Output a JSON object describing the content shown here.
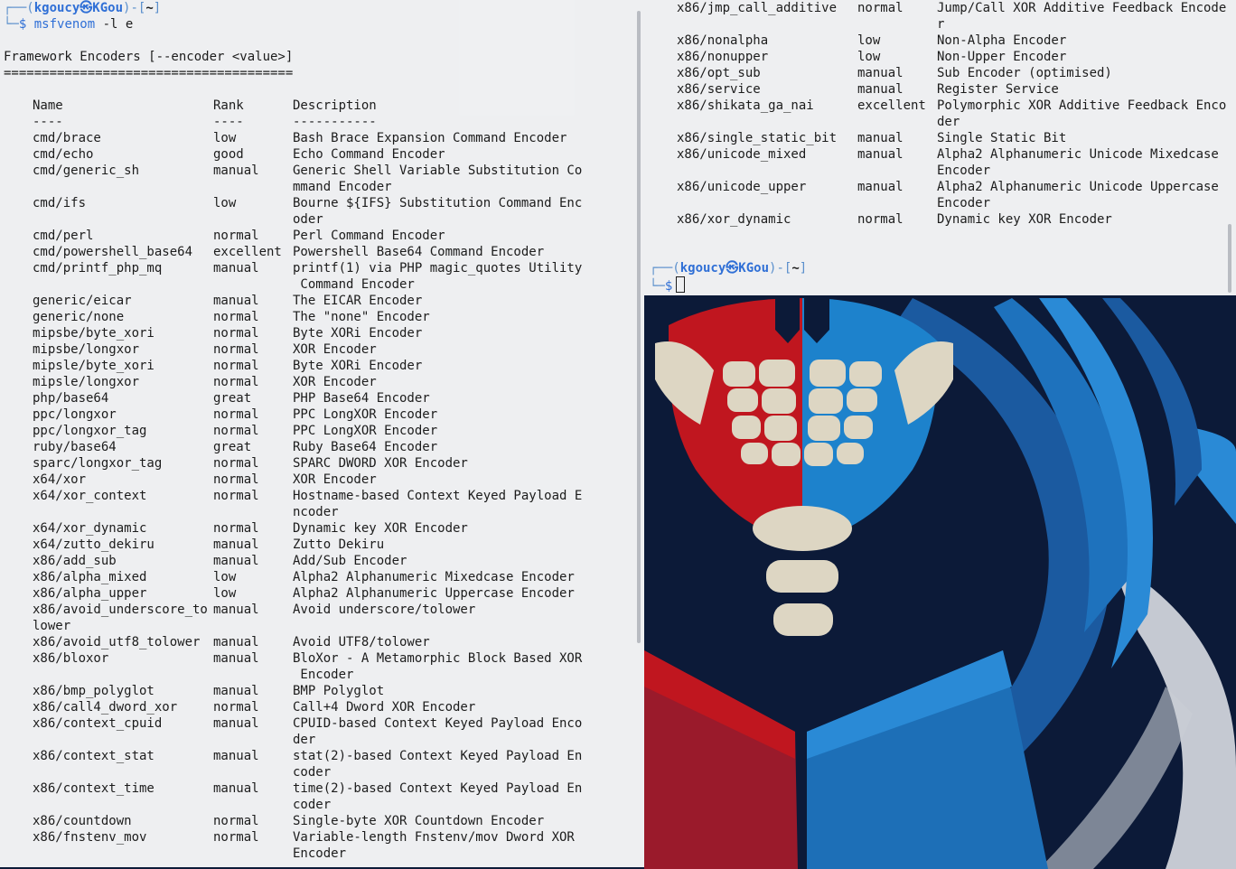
{
  "left_terminal": {
    "prompt": {
      "user": "kgoucy",
      "separator_icon": "㉿",
      "host": "KGou",
      "dir": "~",
      "symbol": "$",
      "command": "msfvenom",
      "args": "-l e"
    },
    "section_title": "Framework Encoders [--encoder <value>]",
    "rule": "======================================",
    "table_headers": {
      "name": "Name",
      "rank": "Rank",
      "desc": "Description"
    },
    "table_dashes": {
      "name": "----",
      "rank": "----",
      "desc": "-----------"
    },
    "rows": [
      {
        "name": "cmd/brace",
        "rank": "low",
        "desc": [
          "Bash Brace Expansion Command Encoder"
        ]
      },
      {
        "name": "cmd/echo",
        "rank": "good",
        "desc": [
          "Echo Command Encoder"
        ]
      },
      {
        "name": "cmd/generic_sh",
        "rank": "manual",
        "desc": [
          "Generic Shell Variable Substitution Co",
          "mmand Encoder"
        ]
      },
      {
        "name": "cmd/ifs",
        "rank": "low",
        "desc": [
          "Bourne ${IFS} Substitution Command Enc",
          "oder"
        ]
      },
      {
        "name": "cmd/perl",
        "rank": "normal",
        "desc": [
          "Perl Command Encoder"
        ]
      },
      {
        "name": "cmd/powershell_base64",
        "rank": "excellent",
        "desc": [
          "Powershell Base64 Command Encoder"
        ]
      },
      {
        "name": "cmd/printf_php_mq",
        "rank": "manual",
        "desc": [
          "printf(1) via PHP magic_quotes Utility",
          " Command Encoder"
        ]
      },
      {
        "name": "generic/eicar",
        "rank": "manual",
        "desc": [
          "The EICAR Encoder"
        ]
      },
      {
        "name": "generic/none",
        "rank": "normal",
        "desc": [
          "The \"none\" Encoder"
        ]
      },
      {
        "name": "mipsbe/byte_xori",
        "rank": "normal",
        "desc": [
          "Byte XORi Encoder"
        ]
      },
      {
        "name": "mipsbe/longxor",
        "rank": "normal",
        "desc": [
          "XOR Encoder"
        ]
      },
      {
        "name": "mipsle/byte_xori",
        "rank": "normal",
        "desc": [
          "Byte XORi Encoder"
        ]
      },
      {
        "name": "mipsle/longxor",
        "rank": "normal",
        "desc": [
          "XOR Encoder"
        ]
      },
      {
        "name": "php/base64",
        "rank": "great",
        "desc": [
          "PHP Base64 Encoder"
        ]
      },
      {
        "name": "ppc/longxor",
        "rank": "normal",
        "desc": [
          "PPC LongXOR Encoder"
        ]
      },
      {
        "name": "ppc/longxor_tag",
        "rank": "normal",
        "desc": [
          "PPC LongXOR Encoder"
        ]
      },
      {
        "name": "ruby/base64",
        "rank": "great",
        "desc": [
          "Ruby Base64 Encoder"
        ]
      },
      {
        "name": "sparc/longxor_tag",
        "rank": "normal",
        "desc": [
          "SPARC DWORD XOR Encoder"
        ]
      },
      {
        "name": "x64/xor",
        "rank": "normal",
        "desc": [
          "XOR Encoder"
        ]
      },
      {
        "name": "x64/xor_context",
        "rank": "normal",
        "desc": [
          "Hostname-based Context Keyed Payload E",
          "ncoder"
        ]
      },
      {
        "name": "x64/xor_dynamic",
        "rank": "normal",
        "desc": [
          "Dynamic key XOR Encoder"
        ]
      },
      {
        "name": "x64/zutto_dekiru",
        "rank": "manual",
        "desc": [
          "Zutto Dekiru"
        ]
      },
      {
        "name": "x86/add_sub",
        "rank": "manual",
        "desc": [
          "Add/Sub Encoder"
        ]
      },
      {
        "name": "x86/alpha_mixed",
        "rank": "low",
        "desc": [
          "Alpha2 Alphanumeric Mixedcase Encoder"
        ]
      },
      {
        "name": "x86/alpha_upper",
        "rank": "low",
        "desc": [
          "Alpha2 Alphanumeric Uppercase Encoder"
        ]
      },
      {
        "name": "x86/avoid_underscore_to",
        "name2": "lower",
        "rank": "manual",
        "desc": [
          "Avoid underscore/tolower"
        ]
      },
      {
        "name": "x86/avoid_utf8_tolower",
        "rank": "manual",
        "desc": [
          "Avoid UTF8/tolower"
        ]
      },
      {
        "name": "x86/bloxor",
        "rank": "manual",
        "desc": [
          "BloXor - A Metamorphic Block Based XOR",
          " Encoder"
        ]
      },
      {
        "name": "x86/bmp_polyglot",
        "rank": "manual",
        "desc": [
          "BMP Polyglot"
        ]
      },
      {
        "name": "x86/call4_dword_xor",
        "rank": "normal",
        "desc": [
          "Call+4 Dword XOR Encoder"
        ]
      },
      {
        "name": "x86/context_cpuid",
        "rank": "manual",
        "desc": [
          "CPUID-based Context Keyed Payload Enco",
          "der"
        ]
      },
      {
        "name": "x86/context_stat",
        "rank": "manual",
        "desc": [
          "stat(2)-based Context Keyed Payload En",
          "coder"
        ]
      },
      {
        "name": "x86/context_time",
        "rank": "manual",
        "desc": [
          "time(2)-based Context Keyed Payload En",
          "coder"
        ]
      },
      {
        "name": "x86/countdown",
        "rank": "normal",
        "desc": [
          "Single-byte XOR Countdown Encoder"
        ]
      },
      {
        "name": "x86/fnstenv_mov",
        "rank": "normal",
        "desc": [
          "Variable-length Fnstenv/mov Dword XOR",
          "Encoder"
        ]
      }
    ]
  },
  "right_terminal": {
    "rows": [
      {
        "name": "x86/jmp_call_additive",
        "rank": "normal",
        "desc": [
          "Jump/Call XOR Additive Feedback Encode",
          "r"
        ]
      },
      {
        "name": "x86/nonalpha",
        "rank": "low",
        "desc": [
          "Non-Alpha Encoder"
        ]
      },
      {
        "name": "x86/nonupper",
        "rank": "low",
        "desc": [
          "Non-Upper Encoder"
        ]
      },
      {
        "name": "x86/opt_sub",
        "rank": "manual",
        "desc": [
          "Sub Encoder (optimised)"
        ]
      },
      {
        "name": "x86/service",
        "rank": "manual",
        "desc": [
          "Register Service"
        ]
      },
      {
        "name": "x86/shikata_ga_nai",
        "rank": "excellent",
        "desc": [
          "Polymorphic XOR Additive Feedback Enco",
          "der"
        ]
      },
      {
        "name": "x86/single_static_bit",
        "rank": "manual",
        "desc": [
          "Single Static Bit"
        ]
      },
      {
        "name": "x86/unicode_mixed",
        "rank": "manual",
        "desc": [
          "Alpha2 Alphanumeric Unicode Mixedcase",
          "Encoder"
        ]
      },
      {
        "name": "x86/unicode_upper",
        "rank": "manual",
        "desc": [
          "Alpha2 Alphanumeric Unicode Uppercase",
          "Encoder"
        ]
      },
      {
        "name": "x86/xor_dynamic",
        "rank": "normal",
        "desc": [
          "Dynamic key XOR Encoder"
        ]
      }
    ],
    "prompt": {
      "user": "kgoucy",
      "separator_icon": "㉿",
      "host": "KGou",
      "dir": "~",
      "symbol": "$"
    }
  },
  "colors": {
    "prompt_blue": "#2f6fd6",
    "wallpaper_navy": "#0c1a38",
    "skull_red": "#c0161f",
    "skull_blue": "#1d82cc",
    "bone": "#ddd6c3"
  }
}
